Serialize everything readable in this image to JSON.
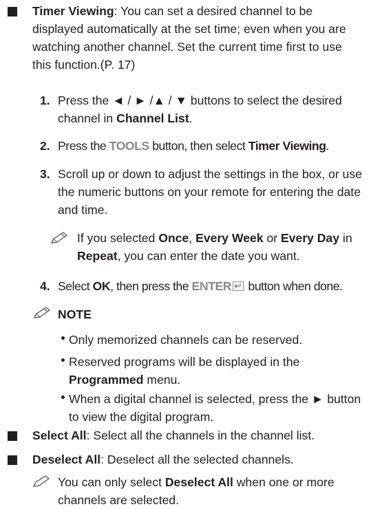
{
  "timer_viewing": {
    "term": "Timer Viewing",
    "text": ": You can set a desired channel to be displayed automatically at the set time; even when you are watching another channel. Set the current time first to use this function.(P. 17)"
  },
  "steps": [
    {
      "number": "1.",
      "pre": "Press the ◄ / ► /▲ / ▼ buttons to select the desired channel in ",
      "bold": "Channel List",
      "post": "."
    },
    {
      "number": "2.",
      "pre": "Press the ",
      "key": "TOOLS",
      "mid": " button, then select ",
      "bold": "Timer Viewing",
      "post": "."
    },
    {
      "number": "3.",
      "text": "Scroll up or down to adjust the settings in the box, or use the numeric buttons on your remote for entering the date and time."
    },
    {
      "number": "4.",
      "pre": "Select ",
      "bold": "OK",
      "mid": ", then press the ",
      "key": "ENTER",
      "post": " button when done."
    }
  ],
  "step3_note": {
    "pre": "If you selected ",
    "b1": "Once",
    "s1": ", ",
    "b2": "Every Week",
    "s2": " or ",
    "b3": "Every Day",
    "s3": " in ",
    "b4": "Repeat",
    "post": ", you can enter the date you want."
  },
  "note": {
    "heading": "NOTE",
    "bullets": [
      {
        "text": "Only memorized channels can be reserved."
      },
      {
        "pre": "Reserved programs will be displayed in the ",
        "bold": "Programmed",
        "post": " menu."
      },
      {
        "text": "When a digital channel is selected, press the ► button to view the digital program."
      }
    ]
  },
  "select_all": {
    "term": "Select All",
    "text": ": Select all the channels in the channel list."
  },
  "deselect_all": {
    "term": "Deselect All",
    "text": ": Deselect all the selected channels."
  },
  "deselect_note": {
    "pre": "You can only select ",
    "bold": "Deselect All",
    "post": " when one or more channels are selected."
  },
  "icons": {
    "bullet": "square-bullet-icon",
    "note": "pencil-note-icon",
    "enter": "enter-key-icon"
  }
}
